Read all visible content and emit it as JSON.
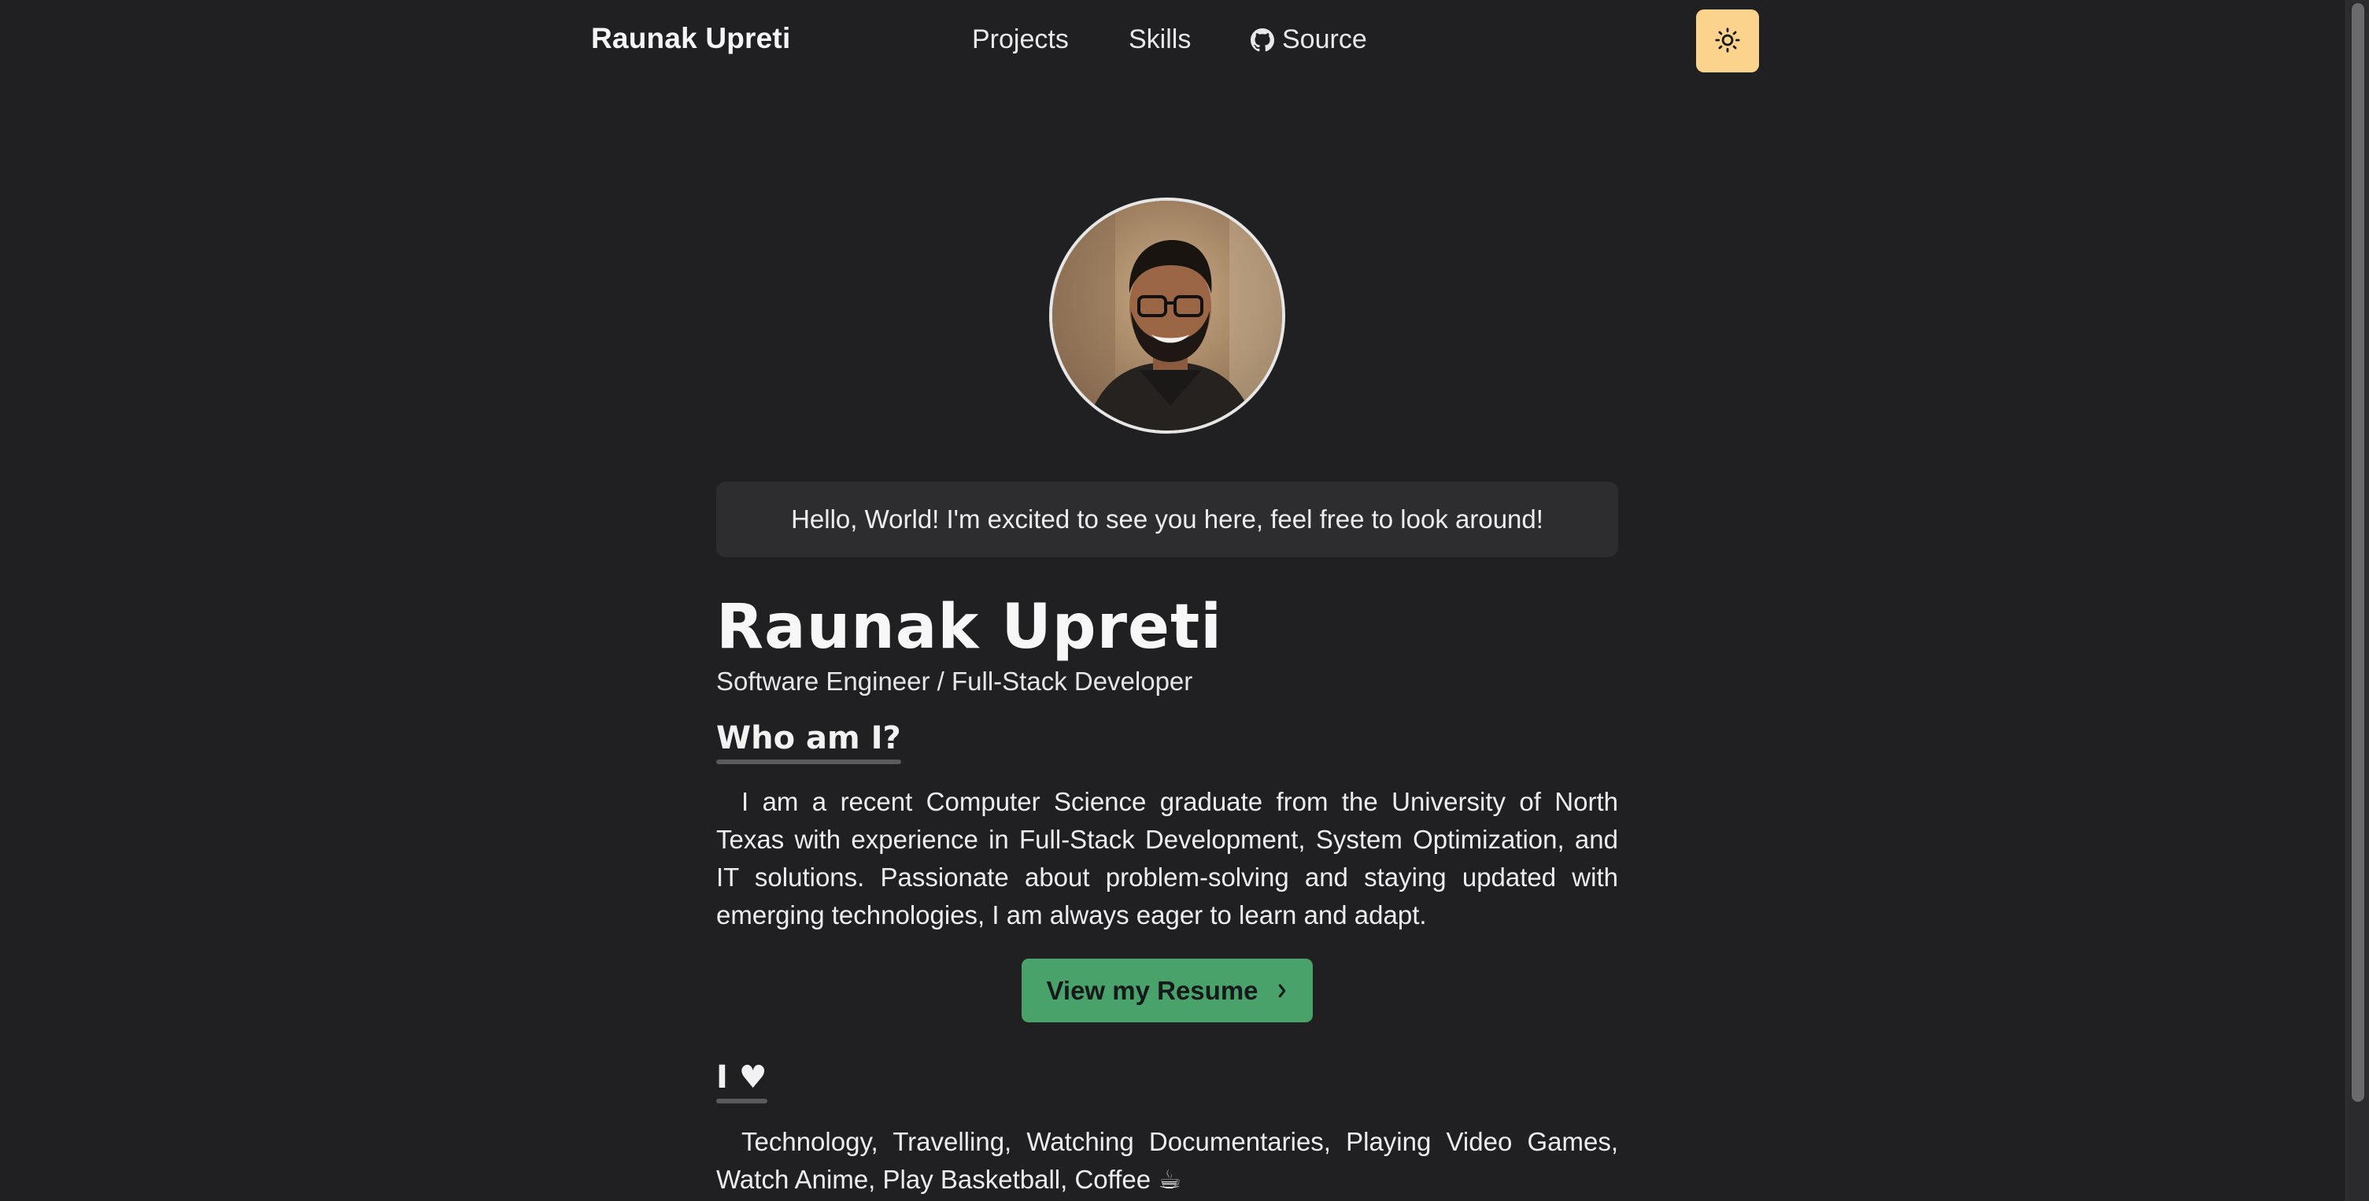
{
  "nav": {
    "brand": "Raunak Upreti",
    "links": [
      {
        "label": "Projects"
      },
      {
        "label": "Skills"
      },
      {
        "label": "Source",
        "icon": "github-icon"
      }
    ],
    "theme_toggle_icon": "sun-icon",
    "theme_toggle_color": "#fbd38d"
  },
  "hero": {
    "avatar_icon": "profile-photo",
    "greeting": "Hello, World! I'm excited to see you here, feel free to look around!",
    "name": "Raunak Upreti",
    "role": "Software Engineer / Full-Stack Developer"
  },
  "about": {
    "title": "Who am I?",
    "text": "I am a recent Computer Science graduate from the University of North Texas with experience in Full-Stack Development, System Optimization, and IT solutions. Passionate about problem-solving and staying updated with emerging technologies, I am always eager to learn and adapt.",
    "resume_button": "View my Resume",
    "resume_button_color": "#48a26a"
  },
  "hobbies": {
    "title": "I ♥",
    "text": "Technology, Travelling, Watching Documentaries, Playing Video Games, Watch Anime, Play Basketball, Coffee ☕"
  },
  "colors": {
    "background": "#202023",
    "card": "#2d2d30",
    "accent_bar": "#5a5a5d"
  }
}
